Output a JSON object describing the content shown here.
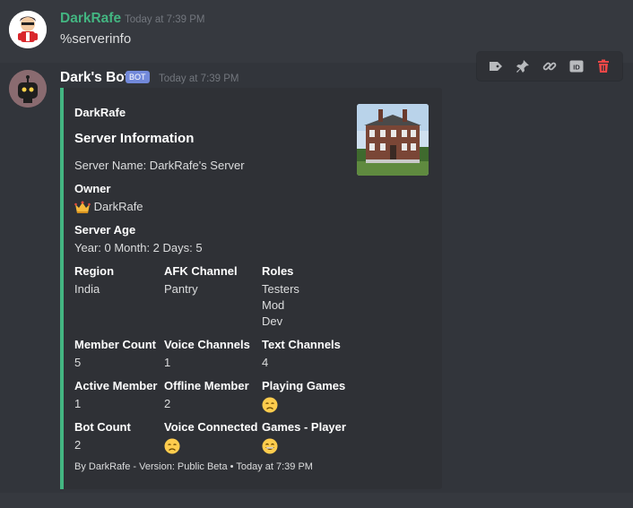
{
  "message1": {
    "author": "DarkRafe",
    "timestamp": "Today at 7:39 PM",
    "content": "%serverinfo"
  },
  "message2": {
    "author": "Dark's Bot",
    "bot_tag": "BOT",
    "timestamp": "Today at 7:39 PM",
    "embed": {
      "color": "#43b581",
      "author_name": "DarkRafe",
      "title": "Server Information",
      "description": "Server Name: DarkRafe's Server",
      "fields": {
        "owner": {
          "name": "Owner",
          "value": "DarkRafe",
          "icon": "crown-emoji"
        },
        "server_age": {
          "name": "Server Age",
          "value": "Year: 0 Month: 2 Days: 5"
        },
        "region": {
          "name": "Region",
          "value": "India"
        },
        "afk_channel": {
          "name": "AFK Channel",
          "value": "Pantry"
        },
        "roles": {
          "name": "Roles",
          "values": [
            "Testers",
            "Mod",
            "Dev"
          ]
        },
        "member_count": {
          "name": "Member Count",
          "value": "5"
        },
        "voice_channels": {
          "name": "Voice Channels",
          "value": "1"
        },
        "text_channels": {
          "name": "Text Channels",
          "value": "4"
        },
        "active_member": {
          "name": "Active Member",
          "value": "1"
        },
        "offline_member": {
          "name": "Offline Member",
          "value": "2"
        },
        "playing_games": {
          "name": "Playing Games",
          "icon": "disappointed-face-emoji"
        },
        "bot_count": {
          "name": "Bot Count",
          "value": "2"
        },
        "voice_connected": {
          "name": "Voice Connected",
          "icon": "disappointed-face-emoji"
        },
        "games_player": {
          "name": "Games - Player",
          "icon": "grinning-face-emoji"
        }
      },
      "footer": "By DarkRafe - Version: Public Beta • Today at 7:39 PM"
    }
  },
  "toolbar": {
    "icons": [
      "tag-icon",
      "pin-icon",
      "link-icon",
      "id-icon",
      "trash-icon"
    ],
    "id_label": "ID"
  },
  "colors": {
    "background": "#36393f",
    "username_green": "#43b581",
    "bot_tag": "#7289da",
    "delete_red": "#f04747"
  }
}
